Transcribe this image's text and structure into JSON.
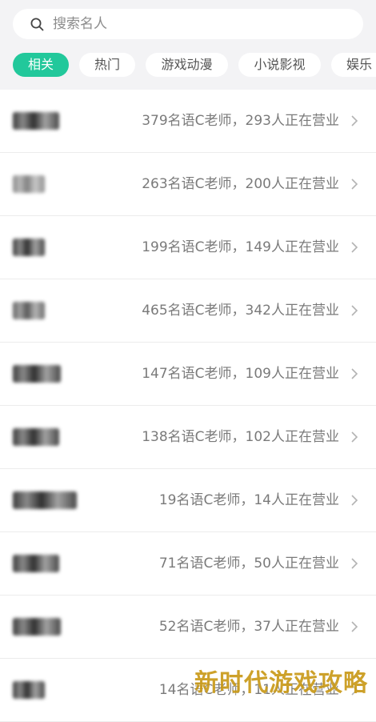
{
  "search": {
    "placeholder": "搜索名人"
  },
  "tabs": [
    "相关",
    "热门",
    "游戏动漫",
    "小说影视",
    "娱乐"
  ],
  "rows": [
    {
      "info": "379名语C老师，293人正在营业"
    },
    {
      "info": "263名语C老师，200人正在营业"
    },
    {
      "info": "199名语C老师，149人正在营业"
    },
    {
      "info": "465名语C老师，342人正在营业"
    },
    {
      "info": "147名语C老师，109人正在营业"
    },
    {
      "info": "138名语C老师，102人正在营业"
    },
    {
      "info": "19名语C老师，14人正在营业"
    },
    {
      "info": "71名语C老师，50人正在营业"
    },
    {
      "info": "52名语C老师，37人正在营业"
    },
    {
      "info": "14名语C老师，11人正在营业"
    }
  ],
  "watermark": "新时代游戏攻略",
  "colors": {
    "accent": "#22c89b",
    "header_bg": "#f3f3f5",
    "watermark": "#c99a18"
  }
}
